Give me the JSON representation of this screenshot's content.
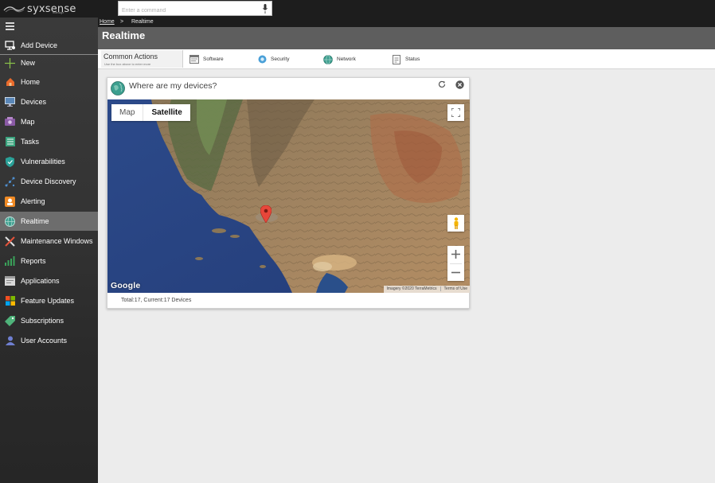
{
  "app": {
    "logo_text": "syxsense",
    "logo_sub": "manage",
    "search_placeholder": "Enter a command"
  },
  "sidebar": {
    "items": [
      {
        "label": "Add Device",
        "icon": "add-device-icon"
      },
      {
        "label": "New",
        "icon": "plus-icon"
      },
      {
        "label": "Home",
        "icon": "home-icon"
      },
      {
        "label": "Devices",
        "icon": "monitor-icon"
      },
      {
        "label": "Map",
        "icon": "map-icon"
      },
      {
        "label": "Tasks",
        "icon": "tasks-icon"
      },
      {
        "label": "Vulnerabilities",
        "icon": "shield-icon"
      },
      {
        "label": "Device Discovery",
        "icon": "discovery-icon"
      },
      {
        "label": "Alerting",
        "icon": "alert-icon"
      },
      {
        "label": "Realtime",
        "icon": "globe-icon",
        "active": true
      },
      {
        "label": "Maintenance Windows",
        "icon": "tools-icon"
      },
      {
        "label": "Reports",
        "icon": "chart-icon"
      },
      {
        "label": "Applications",
        "icon": "applications-icon"
      },
      {
        "label": "Feature Updates",
        "icon": "windows-icon"
      },
      {
        "label": "Subscriptions",
        "icon": "tag-icon"
      },
      {
        "label": "User Accounts",
        "icon": "user-icon"
      }
    ]
  },
  "breadcrumb": {
    "home": "Home",
    "separator": ">",
    "current": "Realtime"
  },
  "page": {
    "title": "Realtime"
  },
  "common_actions": {
    "title": "Common Actions",
    "subtitle": "Use the box above to enter more",
    "items": [
      {
        "label": "Software",
        "icon": "software-icon"
      },
      {
        "label": "Security",
        "icon": "security-icon"
      },
      {
        "label": "Network",
        "icon": "network-icon"
      },
      {
        "label": "Status",
        "icon": "status-icon"
      }
    ]
  },
  "widget": {
    "title": "Where are my devices?",
    "map_type": {
      "map": "Map",
      "satellite": "Satellite",
      "selected": "Satellite"
    },
    "google_logo": "Google",
    "attribution": "Imagery ©2020 TerraMetrics",
    "terms": "Terms of Use",
    "footer": "Total:17, Current:17 Devices"
  },
  "colors": {
    "topbar": "#1d1d1d",
    "sidebar": "#343434",
    "active_item": "#6d6d6d",
    "titlebar": "#5e5e5e",
    "content_bg": "#ececec",
    "pin": "#e8463a"
  }
}
